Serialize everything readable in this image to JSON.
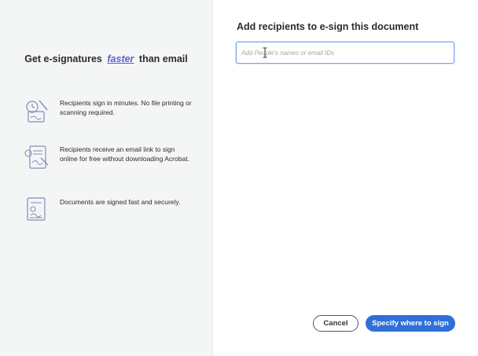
{
  "left_panel": {
    "title_before": "Get e-signatures",
    "title_accent": "faster",
    "title_after": "than email",
    "features": [
      {
        "icon": "signing-clock-icon",
        "text": "Recipients sign in minutes. No file printing or scanning required."
      },
      {
        "icon": "email-sign-document-icon",
        "text": "Recipients receive an email link to sign online for free without downloading Acrobat."
      },
      {
        "icon": "secure-signed-document-icon",
        "text": "Documents are signed fast and securely."
      }
    ]
  },
  "right_panel": {
    "title": "Add recipients to e-sign this document",
    "recipient_placeholder": "Add People's names or email IDs",
    "recipient_value": ""
  },
  "footer": {
    "cancel_label": "Cancel",
    "primary_label": "Specify where to sign"
  },
  "colors": {
    "accent": "#5b5fd6",
    "primary": "#2f6fd8",
    "left_bg": "#f4f5f5"
  }
}
